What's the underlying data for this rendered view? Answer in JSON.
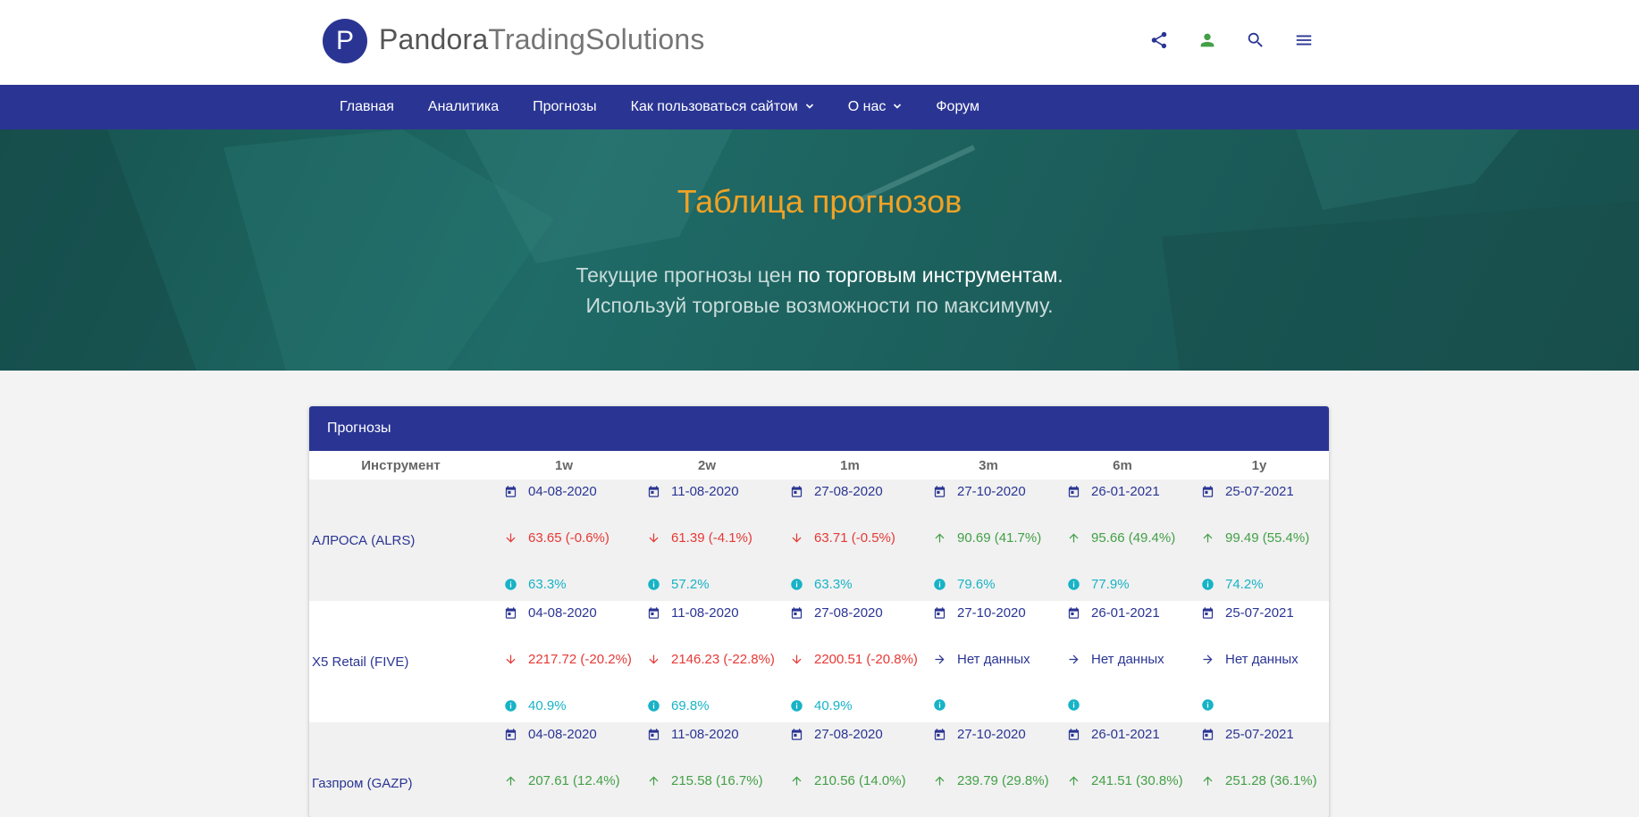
{
  "brand": {
    "logo_letter": "P",
    "name_bold": "Pandora",
    "name_rest": "TradingSolutions"
  },
  "top_icons": [
    "share-icon",
    "account-icon",
    "search-icon",
    "menu-icon"
  ],
  "nav": {
    "items": [
      {
        "label": "Главная",
        "dropdown": false
      },
      {
        "label": "Аналитика",
        "dropdown": false
      },
      {
        "label": "Прогнозы",
        "dropdown": false
      },
      {
        "label": "Как пользоваться сайтом",
        "dropdown": true
      },
      {
        "label": "О нас",
        "dropdown": true
      },
      {
        "label": "Форум",
        "dropdown": false
      }
    ]
  },
  "hero": {
    "title": "Таблица прогнозов",
    "line1_a": "Текущие прогнозы цен ",
    "line1_b": "по торговым инструментам.",
    "line2": "Используй торговые возможности по максимуму."
  },
  "colors": {
    "primary": "#2a3593",
    "accent": "#f0a225",
    "down": "#e53935",
    "up": "#43a047",
    "info": "#17b3c6"
  },
  "card": {
    "title": "Прогнозы",
    "columns": [
      "Инструмент",
      "1w",
      "2w",
      "1m",
      "3m",
      "6m",
      "1y"
    ],
    "rows": [
      {
        "instrument": "АЛРОСА (ALRS)",
        "cells": [
          {
            "date": "04-08-2020",
            "value": "63.65 (-0.6%)",
            "dir": "down",
            "prob": "63.3%"
          },
          {
            "date": "11-08-2020",
            "value": "61.39 (-4.1%)",
            "dir": "down",
            "prob": "57.2%"
          },
          {
            "date": "27-08-2020",
            "value": "63.71 (-0.5%)",
            "dir": "down",
            "prob": "63.3%"
          },
          {
            "date": "27-10-2020",
            "value": "90.69 (41.7%)",
            "dir": "up",
            "prob": "79.6%"
          },
          {
            "date": "26-01-2021",
            "value": "95.66 (49.4%)",
            "dir": "up",
            "prob": "77.9%"
          },
          {
            "date": "25-07-2021",
            "value": "99.49 (55.4%)",
            "dir": "up",
            "prob": "74.2%"
          }
        ]
      },
      {
        "instrument": "X5 Retail (FIVE)",
        "cells": [
          {
            "date": "04-08-2020",
            "value": "2217.72 (-20.2%)",
            "dir": "down",
            "prob": "40.9%"
          },
          {
            "date": "11-08-2020",
            "value": "2146.23 (-22.8%)",
            "dir": "down",
            "prob": "69.8%"
          },
          {
            "date": "27-08-2020",
            "value": "2200.51 (-20.8%)",
            "dir": "down",
            "prob": "40.9%"
          },
          {
            "date": "27-10-2020",
            "value": "Нет данных",
            "dir": "none",
            "prob": ""
          },
          {
            "date": "26-01-2021",
            "value": "Нет данных",
            "dir": "none",
            "prob": ""
          },
          {
            "date": "25-07-2021",
            "value": "Нет данных",
            "dir": "none",
            "prob": ""
          }
        ]
      },
      {
        "instrument": "Газпром (GAZP)",
        "cells": [
          {
            "date": "04-08-2020",
            "value": "207.61 (12.4%)",
            "dir": "up",
            "prob": ""
          },
          {
            "date": "11-08-2020",
            "value": "215.58 (16.7%)",
            "dir": "up",
            "prob": ""
          },
          {
            "date": "27-08-2020",
            "value": "210.56 (14.0%)",
            "dir": "up",
            "prob": ""
          },
          {
            "date": "27-10-2020",
            "value": "239.79 (29.8%)",
            "dir": "up",
            "prob": ""
          },
          {
            "date": "26-01-2021",
            "value": "241.51 (30.8%)",
            "dir": "up",
            "prob": ""
          },
          {
            "date": "25-07-2021",
            "value": "251.28 (36.1%)",
            "dir": "up",
            "prob": ""
          }
        ]
      }
    ]
  }
}
